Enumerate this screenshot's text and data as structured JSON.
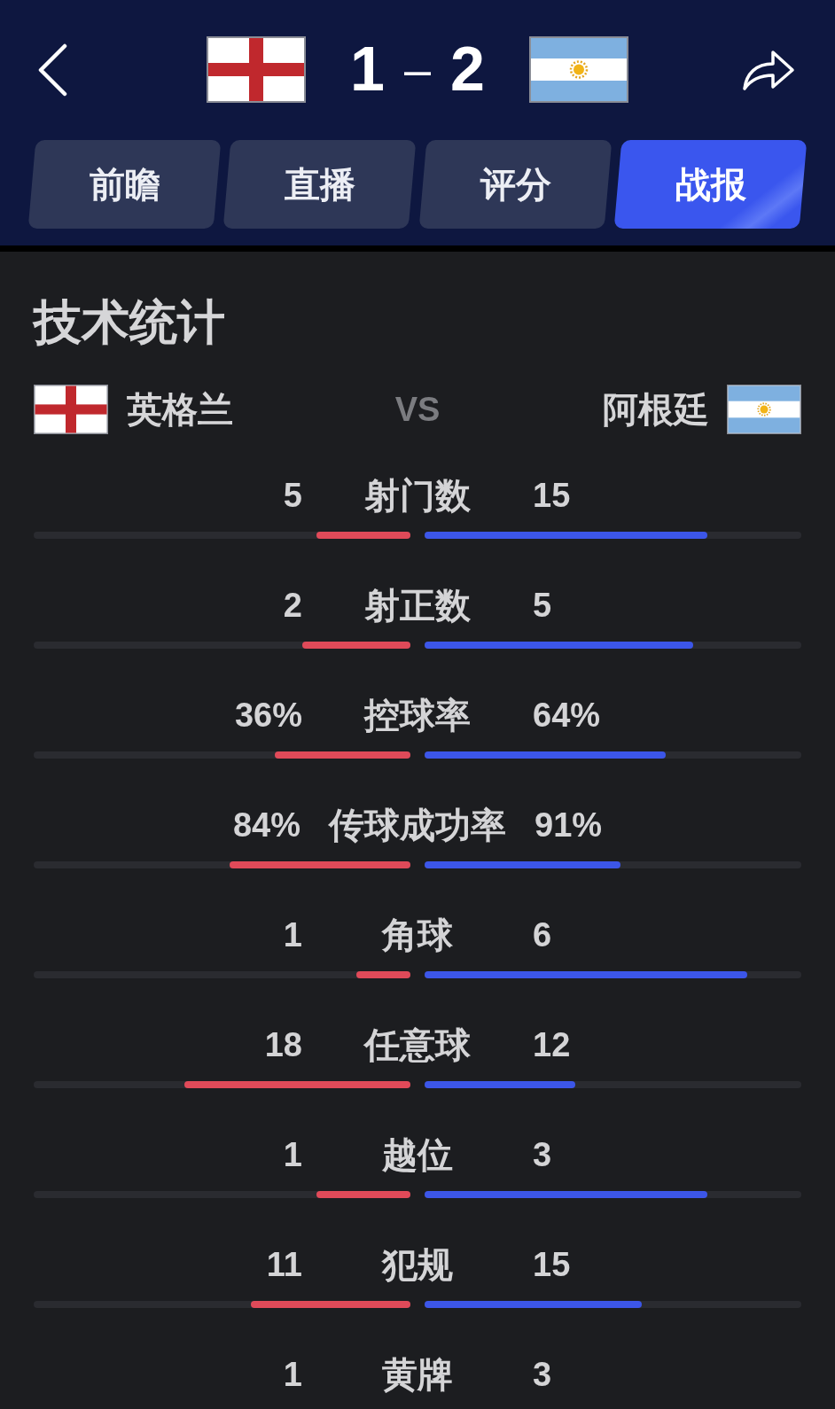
{
  "header": {
    "score": {
      "home": "1",
      "separator": "–",
      "away": "2"
    }
  },
  "tabs": [
    {
      "label": "前瞻",
      "selected": false
    },
    {
      "label": "直播",
      "selected": false
    },
    {
      "label": "评分",
      "selected": false
    },
    {
      "label": "战报",
      "selected": true
    }
  ],
  "stats_section": {
    "title": "技术统计",
    "home_team": "英格兰",
    "versus": "VS",
    "away_team": "阿根廷"
  },
  "stats": [
    {
      "label": "射门数",
      "home": {
        "value": "5",
        "level": 0.25
      },
      "away": {
        "value": "15",
        "level": 0.75
      }
    },
    {
      "label": "射正数",
      "home": {
        "value": "2",
        "level": 0.286
      },
      "away": {
        "value": "5",
        "level": 0.714
      }
    },
    {
      "label": "控球率",
      "home": {
        "value": "36%",
        "level": 0.36
      },
      "away": {
        "value": "64%",
        "level": 0.64
      }
    },
    {
      "label": "传球成功率",
      "home": {
        "value": "84%",
        "level": 0.48
      },
      "away": {
        "value": "91%",
        "level": 0.52
      }
    },
    {
      "label": "角球",
      "home": {
        "value": "1",
        "level": 0.143
      },
      "away": {
        "value": "6",
        "level": 0.857
      }
    },
    {
      "label": "任意球",
      "home": {
        "value": "18",
        "level": 0.6
      },
      "away": {
        "value": "12",
        "level": 0.4
      }
    },
    {
      "label": "越位",
      "home": {
        "value": "1",
        "level": 0.25
      },
      "away": {
        "value": "3",
        "level": 0.75
      }
    },
    {
      "label": "犯规",
      "home": {
        "value": "11",
        "level": 0.423
      },
      "away": {
        "value": "15",
        "level": 0.577
      }
    },
    {
      "label": "黄牌",
      "home": {
        "value": "1"
      },
      "away": {
        "value": "3"
      }
    }
  ]
}
